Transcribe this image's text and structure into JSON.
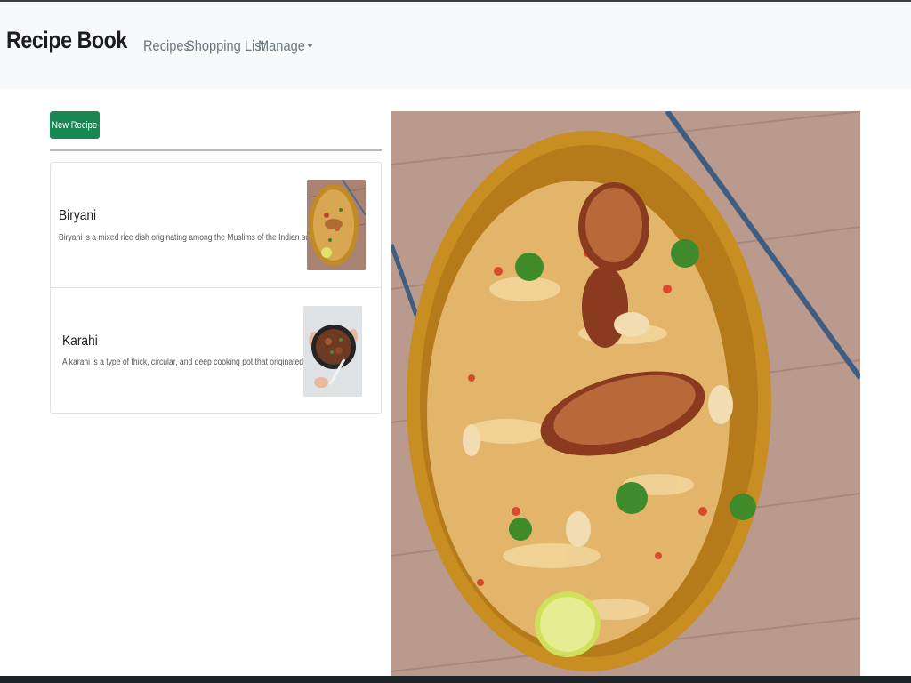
{
  "app": {
    "brand": "Recipe Book"
  },
  "nav": {
    "recipes": "Recipes",
    "shopping_list": "Shopping List",
    "manage": "Manage"
  },
  "actions": {
    "new_recipe": "New Recipe"
  },
  "recipes": [
    {
      "name": "Biryani",
      "description": "Biryani is a mixed rice dish originating among the Muslims of the Indian su...",
      "image": "biryani-plate"
    },
    {
      "name": "Karahi",
      "description": "A karahi is a type of thick, circular, and deep cooking pot that originated...",
      "image": "karahi-pot"
    }
  ],
  "detail": {
    "image": "biryani-plate"
  },
  "colors": {
    "navbar_bg": "#f8f9fa",
    "brand_text": "#1d1d1f",
    "nav_link": "#6c757d",
    "success_button": "#198754",
    "plate_gold": "#c98e22",
    "table_wood": "#b99a8d"
  }
}
